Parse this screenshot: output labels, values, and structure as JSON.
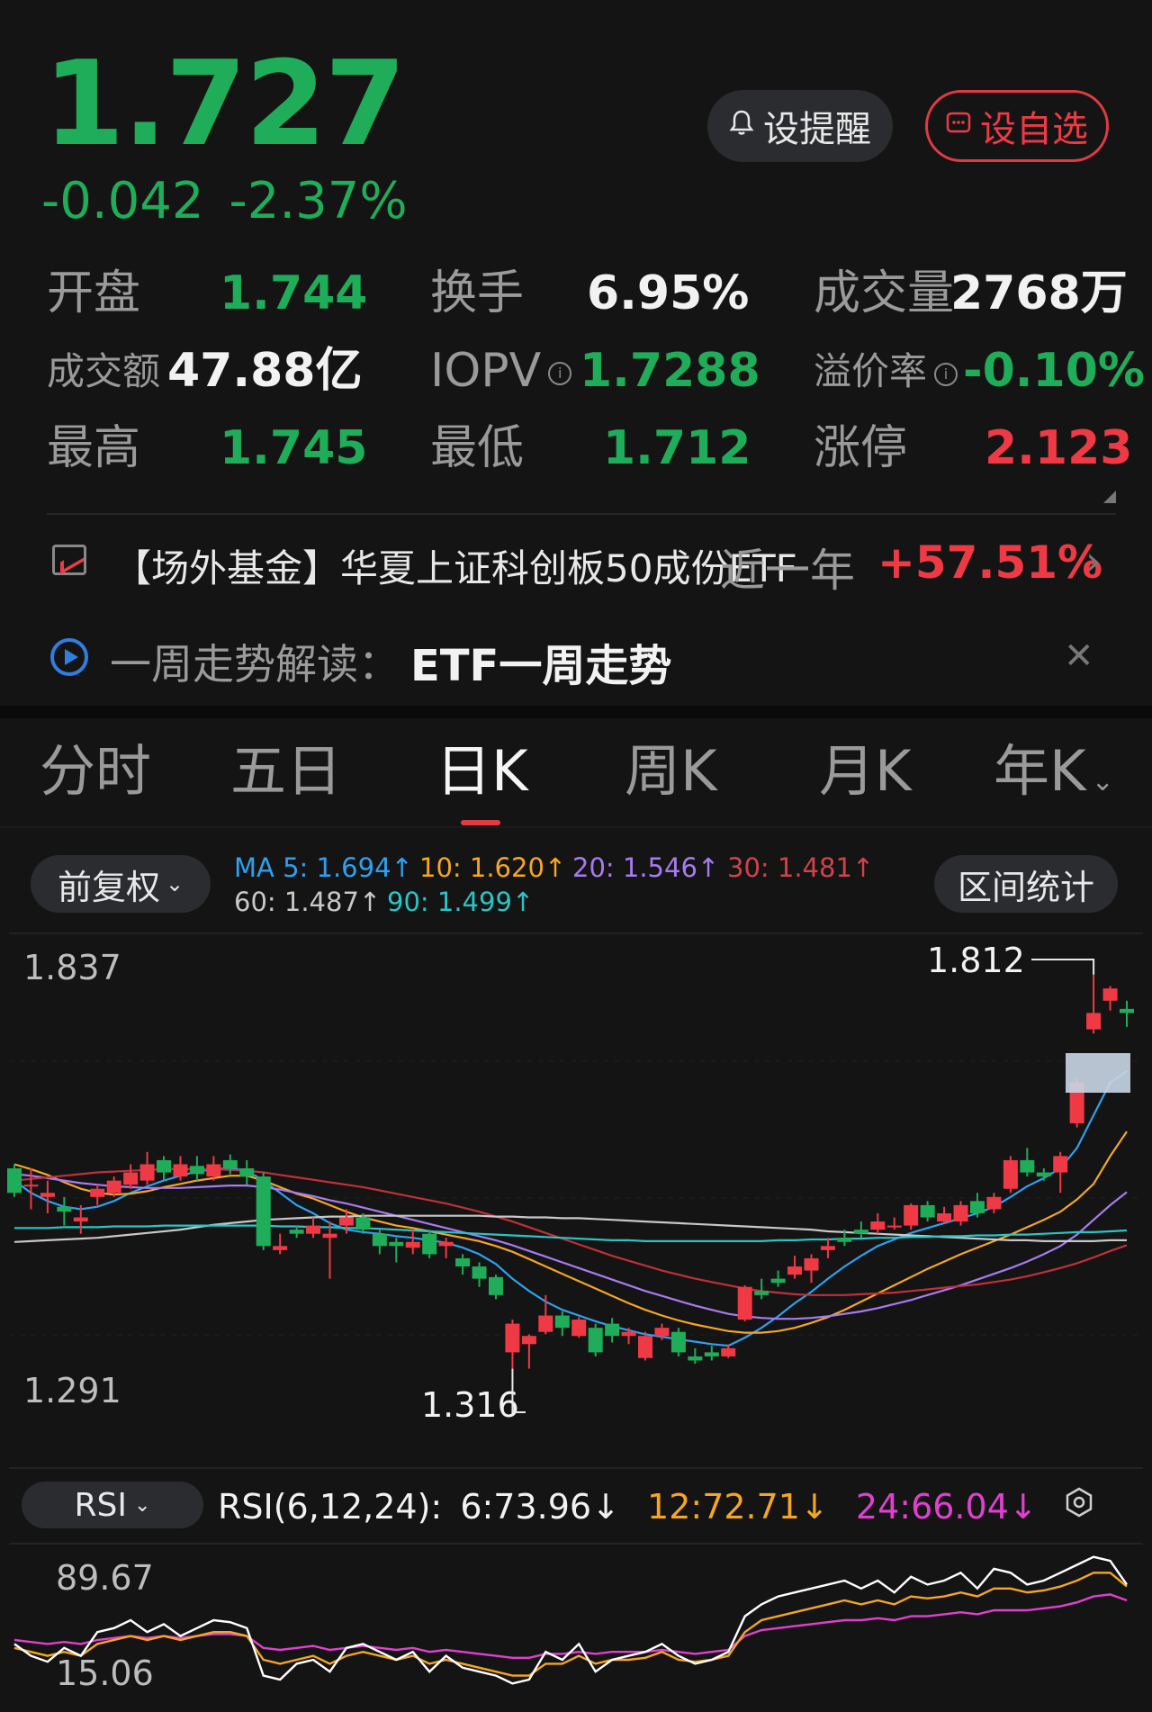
{
  "quote": {
    "price": "1.727",
    "change": "-0.042",
    "change_pct": "-2.37%"
  },
  "actions": {
    "alert_label": "设提醒",
    "watch_label": "设自选"
  },
  "stats": {
    "open_label": "开盘",
    "open_value": "1.744",
    "turnover_label": "换手",
    "turnover_value": "6.95%",
    "volume_label": "成交量",
    "volume_value": "2768万",
    "amount_label": "成交额",
    "amount_value": "47.88亿",
    "iopv_label": "IOPV",
    "iopv_value": "1.7288",
    "premium_label": "溢价率",
    "premium_value": "-0.10%",
    "high_label": "最高",
    "high_value": "1.745",
    "low_label": "最低",
    "low_value": "1.712",
    "limit_up_label": "涨停",
    "limit_up_value": "2.123"
  },
  "fund": {
    "text": "【场外基金】华夏上证科创板50成份ETF",
    "period": "近一年",
    "return": "+57.51%"
  },
  "weekly": {
    "label": "一周走势解读：",
    "title": "ETF一周走势"
  },
  "tabs": [
    "分时",
    "五日",
    "日K",
    "周K",
    "月K",
    "年K"
  ],
  "active_tab": "日K",
  "chart_controls": {
    "adjust_label": "前复权",
    "range_stats_label": "区间统计"
  },
  "ma_legend": {
    "ma5": "MA 5: 1.694↑",
    "ma10": "10: 1.620↑",
    "ma20": "20: 1.546↑",
    "ma30": "30: 1.481↑",
    "ma60": "60: 1.487↑",
    "ma90": "90: 1.499↑"
  },
  "colors": {
    "up": "#ef3a46",
    "down": "#1fad5a",
    "ma5": "#2fa0f0",
    "ma10": "#f5a623",
    "ma20": "#a77bf0",
    "ma30": "#c0303a",
    "ma60": "#c8c8c8",
    "ma90": "#2bc4c4",
    "rsi6": "#ffffff",
    "rsi12": "#f5a623",
    "rsi24": "#e040d0"
  },
  "chart_data": {
    "type": "candlestick",
    "y_axis_top": "1.837",
    "y_axis_bottom": "1.291",
    "ylim": [
      1.291,
      1.837
    ],
    "max_marker": "1.812",
    "min_marker": "1.316",
    "candles": [
      [
        1.575,
        1.545,
        1.58,
        1.54
      ],
      [
        1.555,
        1.555,
        1.575,
        1.525
      ],
      [
        1.54,
        1.545,
        1.56,
        1.52
      ],
      [
        1.528,
        1.522,
        1.54,
        1.505
      ],
      [
        1.51,
        1.515,
        1.53,
        1.495
      ],
      [
        1.54,
        1.55,
        1.555,
        1.53
      ],
      [
        1.545,
        1.56,
        1.565,
        1.54
      ],
      [
        1.555,
        1.57,
        1.58,
        1.55
      ],
      [
        1.56,
        1.58,
        1.595,
        1.555
      ],
      [
        1.585,
        1.57,
        1.59,
        1.56
      ],
      [
        1.565,
        1.58,
        1.59,
        1.56
      ],
      [
        1.578,
        1.568,
        1.59,
        1.56
      ],
      [
        1.565,
        1.58,
        1.59,
        1.56
      ],
      [
        1.585,
        1.575,
        1.592,
        1.568
      ],
      [
        1.575,
        1.565,
        1.585,
        1.555
      ],
      [
        1.565,
        1.48,
        1.57,
        1.475
      ],
      [
        1.475,
        1.48,
        1.495,
        1.47
      ],
      [
        1.5,
        1.495,
        1.505,
        1.49
      ],
      [
        1.495,
        1.505,
        1.515,
        1.49
      ],
      [
        1.49,
        1.495,
        1.51,
        1.44
      ],
      [
        1.505,
        1.515,
        1.525,
        1.495
      ],
      [
        1.515,
        1.5,
        1.52,
        1.495
      ],
      [
        1.495,
        1.48,
        1.5,
        1.47
      ],
      [
        1.485,
        1.48,
        1.49,
        1.46
      ],
      [
        1.478,
        1.485,
        1.5,
        1.47
      ],
      [
        1.495,
        1.47,
        1.5,
        1.465
      ],
      [
        1.48,
        1.485,
        1.49,
        1.465
      ],
      [
        1.465,
        1.455,
        1.47,
        1.445
      ],
      [
        1.455,
        1.44,
        1.46,
        1.43
      ],
      [
        1.442,
        1.42,
        1.445,
        1.415
      ],
      [
        1.35,
        1.385,
        1.39,
        1.33
      ],
      [
        1.36,
        1.37,
        1.372,
        1.33
      ],
      [
        1.375,
        1.395,
        1.42,
        1.372
      ],
      [
        1.395,
        1.38,
        1.4,
        1.37
      ],
      [
        1.37,
        1.39,
        1.393,
        1.368
      ],
      [
        1.38,
        1.35,
        1.385,
        1.345
      ],
      [
        1.385,
        1.37,
        1.392,
        1.362
      ],
      [
        1.37,
        1.375,
        1.38,
        1.36
      ],
      [
        1.343,
        1.37,
        1.375,
        1.34
      ],
      [
        1.37,
        1.38,
        1.385,
        1.365
      ],
      [
        1.375,
        1.35,
        1.38,
        1.345
      ],
      [
        1.345,
        1.34,
        1.355,
        1.336
      ],
      [
        1.35,
        1.345,
        1.358,
        1.34
      ],
      [
        1.345,
        1.355,
        1.36,
        1.343
      ],
      [
        1.39,
        1.43,
        1.432,
        1.388
      ],
      [
        1.425,
        1.42,
        1.44,
        1.415
      ],
      [
        1.44,
        1.435,
        1.45,
        1.43
      ],
      [
        1.445,
        1.455,
        1.468,
        1.44
      ],
      [
        1.45,
        1.465,
        1.47,
        1.435
      ],
      [
        1.475,
        1.48,
        1.49,
        1.465
      ],
      [
        1.49,
        1.485,
        1.5,
        1.48
      ],
      [
        1.5,
        1.495,
        1.51,
        1.49
      ],
      [
        1.5,
        1.51,
        1.52,
        1.495
      ],
      [
        1.505,
        1.505,
        1.515,
        1.5
      ],
      [
        1.505,
        1.53,
        1.532,
        1.5
      ],
      [
        1.53,
        1.515,
        1.535,
        1.51
      ],
      [
        1.51,
        1.52,
        1.528,
        1.508
      ],
      [
        1.51,
        1.53,
        1.535,
        1.505
      ],
      [
        1.535,
        1.52,
        1.545,
        1.515
      ],
      [
        1.525,
        1.54,
        1.545,
        1.52
      ],
      [
        1.55,
        1.585,
        1.59,
        1.545
      ],
      [
        1.585,
        1.57,
        1.6,
        1.565
      ],
      [
        1.57,
        1.565,
        1.575,
        1.56
      ],
      [
        1.57,
        1.59,
        1.595,
        1.545
      ],
      [
        1.63,
        1.68,
        1.685,
        1.625
      ],
      [
        1.745,
        1.765,
        1.812,
        1.74
      ],
      [
        1.78,
        1.795,
        1.798,
        1.768
      ],
      [
        1.77,
        1.765,
        1.78,
        1.748
      ]
    ],
    "series": [
      {
        "name": "MA 5",
        "values": [
          1.56,
          1.545,
          1.535,
          1.528,
          1.525,
          1.528,
          1.535,
          1.545,
          1.553,
          1.56,
          1.566,
          1.571,
          1.574,
          1.575,
          1.572,
          1.56,
          1.545,
          1.53,
          1.52,
          1.508,
          1.5,
          1.497,
          1.495,
          1.492,
          1.49,
          1.487,
          1.484,
          1.478,
          1.47,
          1.458,
          1.44,
          1.425,
          1.412,
          1.402,
          1.395,
          1.388,
          1.382,
          1.377,
          1.372,
          1.369,
          1.366,
          1.363,
          1.36,
          1.358,
          1.368,
          1.38,
          1.394,
          1.41,
          1.424,
          1.44,
          1.455,
          1.468,
          1.48,
          1.488,
          1.496,
          1.502,
          1.508,
          1.514,
          1.52,
          1.528,
          1.54,
          1.553,
          1.563,
          1.575,
          1.6,
          1.64,
          1.68,
          1.694
        ]
      },
      {
        "name": "10",
        "values": [
          1.58,
          1.574,
          1.567,
          1.558,
          1.55,
          1.545,
          1.543,
          1.544,
          1.547,
          1.552,
          1.556,
          1.56,
          1.563,
          1.566,
          1.566,
          1.56,
          1.552,
          1.544,
          1.538,
          1.53,
          1.522,
          1.515,
          1.51,
          1.505,
          1.502,
          1.498,
          1.494,
          1.49,
          1.486,
          1.48,
          1.473,
          1.464,
          1.455,
          1.446,
          1.437,
          1.428,
          1.419,
          1.41,
          1.402,
          1.395,
          1.389,
          1.384,
          1.38,
          1.376,
          1.374,
          1.374,
          1.376,
          1.38,
          1.386,
          1.393,
          1.402,
          1.412,
          1.422,
          1.432,
          1.442,
          1.452,
          1.461,
          1.47,
          1.478,
          1.486,
          1.494,
          1.503,
          1.512,
          1.522,
          1.537,
          1.556,
          1.59,
          1.62
        ]
      },
      {
        "name": "20",
        "values": [
          1.568,
          1.566,
          1.563,
          1.56,
          1.557,
          1.555,
          1.553,
          1.552,
          1.551,
          1.551,
          1.551,
          1.552,
          1.553,
          1.554,
          1.554,
          1.552,
          1.549,
          1.545,
          1.541,
          1.536,
          1.532,
          1.527,
          1.522,
          1.517,
          1.512,
          1.507,
          1.502,
          1.497,
          1.492,
          1.487,
          1.481,
          1.474,
          1.467,
          1.46,
          1.453,
          1.446,
          1.439,
          1.432,
          1.425,
          1.419,
          1.413,
          1.407,
          1.402,
          1.397,
          1.394,
          1.392,
          1.391,
          1.391,
          1.392,
          1.394,
          1.397,
          1.4,
          1.404,
          1.409,
          1.414,
          1.42,
          1.426,
          1.432,
          1.439,
          1.446,
          1.453,
          1.461,
          1.47,
          1.48,
          1.494,
          1.512,
          1.53,
          1.546
        ]
      },
      {
        "name": "30",
        "values": [
          1.56,
          1.562,
          1.564,
          1.566,
          1.568,
          1.57,
          1.571,
          1.572,
          1.573,
          1.574,
          1.574,
          1.574,
          1.574,
          1.573,
          1.572,
          1.57,
          1.567,
          1.564,
          1.561,
          1.558,
          1.555,
          1.552,
          1.548,
          1.544,
          1.54,
          1.536,
          1.532,
          1.527,
          1.522,
          1.516,
          1.51,
          1.503,
          1.496,
          1.489,
          1.482,
          1.475,
          1.468,
          1.462,
          1.456,
          1.45,
          1.445,
          1.44,
          1.436,
          1.432,
          1.428,
          1.425,
          1.423,
          1.421,
          1.42,
          1.42,
          1.42,
          1.421,
          1.422,
          1.423,
          1.425,
          1.427,
          1.429,
          1.431,
          1.433,
          1.436,
          1.439,
          1.443,
          1.448,
          1.453,
          1.459,
          1.466,
          1.474,
          1.481
        ]
      },
      {
        "name": "60",
        "values": [
          1.485,
          1.486,
          1.487,
          1.488,
          1.489,
          1.49,
          1.492,
          1.494,
          1.496,
          1.498,
          1.5,
          1.503,
          1.506,
          1.508,
          1.51,
          1.512,
          1.513,
          1.514,
          1.515,
          1.516,
          1.516,
          1.517,
          1.517,
          1.517,
          1.517,
          1.517,
          1.517,
          1.517,
          1.517,
          1.516,
          1.516,
          1.515,
          1.515,
          1.514,
          1.514,
          1.513,
          1.512,
          1.511,
          1.51,
          1.509,
          1.508,
          1.507,
          1.506,
          1.505,
          1.504,
          1.503,
          1.502,
          1.501,
          1.5,
          1.498,
          1.497,
          1.496,
          1.495,
          1.494,
          1.493,
          1.492,
          1.491,
          1.49,
          1.489,
          1.488,
          1.487,
          1.487,
          1.486,
          1.486,
          1.486,
          1.486,
          1.487,
          1.487
        ]
      },
      {
        "name": "90",
        "values": [
          1.502,
          1.502,
          1.502,
          1.503,
          1.503,
          1.503,
          1.504,
          1.504,
          1.504,
          1.505,
          1.505,
          1.505,
          1.505,
          1.505,
          1.505,
          1.505,
          1.504,
          1.504,
          1.503,
          1.503,
          1.502,
          1.502,
          1.501,
          1.5,
          1.499,
          1.498,
          1.497,
          1.496,
          1.495,
          1.494,
          1.493,
          1.492,
          1.491,
          1.49,
          1.489,
          1.488,
          1.487,
          1.487,
          1.486,
          1.486,
          1.486,
          1.486,
          1.486,
          1.486,
          1.486,
          1.486,
          1.487,
          1.487,
          1.488,
          1.488,
          1.489,
          1.489,
          1.49,
          1.49,
          1.491,
          1.491,
          1.492,
          1.492,
          1.493,
          1.493,
          1.494,
          1.494,
          1.495,
          1.496,
          1.497,
          1.497,
          1.498,
          1.499
        ]
      }
    ],
    "rsi": {
      "label": "RSI",
      "params_label": "RSI(6,12,24):",
      "rsi6_label": "6:73.96↓",
      "rsi12_label": "12:72.71↓",
      "rsi24_label": "24:66.04↓",
      "y_top": "89.67",
      "y_bottom": "15.06",
      "ylim": [
        15.06,
        89.67
      ],
      "rsi6": [
        44,
        38,
        35,
        42,
        38,
        50,
        52,
        56,
        50,
        54,
        48,
        52,
        56,
        55,
        52,
        28,
        26,
        34,
        36,
        30,
        42,
        44,
        40,
        36,
        40,
        30,
        38,
        32,
        30,
        28,
        24,
        26,
        40,
        36,
        44,
        30,
        36,
        38,
        40,
        44,
        38,
        34,
        36,
        40,
        58,
        64,
        68,
        70,
        72,
        74,
        76,
        72,
        76,
        70,
        78,
        74,
        76,
        80,
        72,
        82,
        80,
        74,
        76,
        80,
        84,
        88,
        86,
        74
      ],
      "rsi12": [
        42,
        40,
        38,
        40,
        38,
        44,
        46,
        48,
        46,
        48,
        46,
        48,
        50,
        50,
        48,
        36,
        34,
        36,
        38,
        34,
        38,
        40,
        38,
        36,
        38,
        34,
        36,
        34,
        32,
        30,
        28,
        28,
        34,
        34,
        38,
        34,
        36,
        36,
        37,
        40,
        36,
        35,
        36,
        38,
        50,
        56,
        58,
        60,
        62,
        64,
        66,
        64,
        66,
        64,
        68,
        67,
        68,
        70,
        68,
        72,
        72,
        70,
        71,
        73,
        76,
        80,
        80,
        73
      ],
      "rsi24": [
        46,
        45,
        44,
        45,
        44,
        46,
        47,
        48,
        47,
        48,
        47,
        48,
        49,
        49,
        48,
        42,
        41,
        42,
        43,
        41,
        42,
        43,
        42,
        41,
        42,
        40,
        41,
        40,
        39,
        38,
        37,
        37,
        39,
        39,
        40,
        39,
        40,
        40,
        40,
        41,
        40,
        39,
        40,
        41,
        48,
        51,
        52,
        53,
        54,
        55,
        56,
        56,
        57,
        56,
        58,
        58,
        59,
        60,
        59,
        61,
        61,
        61,
        62,
        63,
        65,
        68,
        69,
        66
      ]
    }
  }
}
